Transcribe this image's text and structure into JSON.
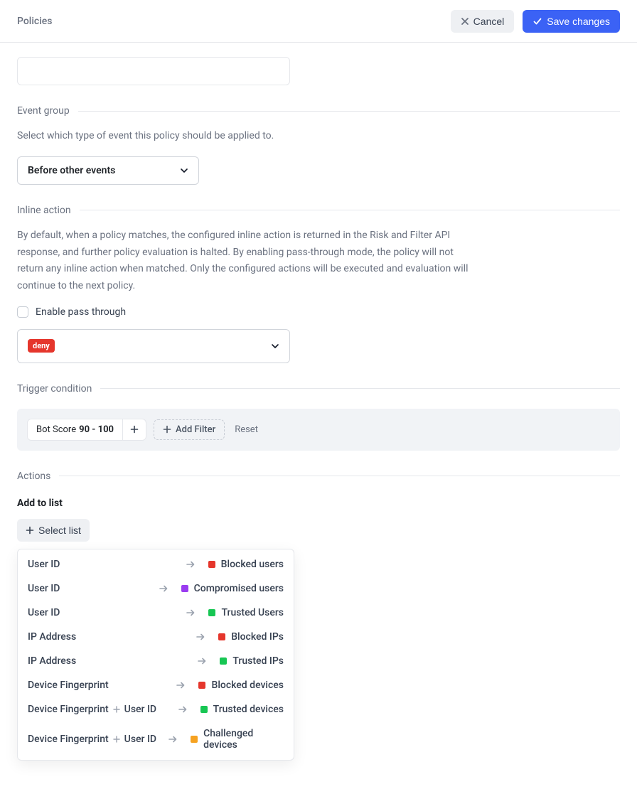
{
  "header": {
    "title": "Policies",
    "cancel_label": "Cancel",
    "save_label": "Save changes"
  },
  "event_group": {
    "heading": "Event group",
    "description": "Select which type of event this policy should be applied to.",
    "selected": "Before other events"
  },
  "inline_action": {
    "heading": "Inline action",
    "description": "By default, when a policy matches, the configured inline action is returned in the Risk and Filter API response, and further policy evaluation is halted. By enabling pass-through mode, the policy will not return any inline action when matched. Only the configured actions will be executed and evaluation will continue to the next policy.",
    "pass_through_label": "Enable pass through",
    "selected_action": "deny"
  },
  "trigger": {
    "heading": "Trigger condition",
    "chip_prefix": "Bot Score",
    "chip_value": "90 - 100",
    "add_filter_label": "Add Filter",
    "reset_label": "Reset"
  },
  "actions": {
    "heading": "Actions",
    "add_to_list_label": "Add to list",
    "select_list_label": "Select list",
    "lists": [
      {
        "keys": [
          "User ID"
        ],
        "color": "red",
        "target": "Blocked users"
      },
      {
        "keys": [
          "User ID"
        ],
        "color": "purple",
        "target": "Compromised users"
      },
      {
        "keys": [
          "User ID"
        ],
        "color": "green",
        "target": "Trusted Users"
      },
      {
        "keys": [
          "IP Address"
        ],
        "color": "red",
        "target": "Blocked IPs"
      },
      {
        "keys": [
          "IP Address"
        ],
        "color": "green",
        "target": "Trusted IPs"
      },
      {
        "keys": [
          "Device Fingerprint"
        ],
        "color": "red",
        "target": "Blocked devices"
      },
      {
        "keys": [
          "Device Fingerprint",
          "User ID"
        ],
        "color": "green",
        "target": "Trusted devices"
      },
      {
        "keys": [
          "Device Fingerprint",
          "User ID"
        ],
        "color": "orange",
        "target": "Challenged devices"
      }
    ]
  }
}
